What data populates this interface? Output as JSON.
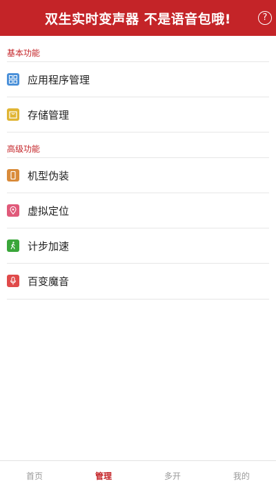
{
  "header": {
    "title": "双生实时变声器 不是语音包哦!",
    "help_glyph": "?",
    "color": "#c42428"
  },
  "sections": {
    "basic": {
      "title": "基本功能",
      "items": [
        {
          "label": "应用程序管理",
          "icon": "grid-apps-icon",
          "color": "#4a90d9"
        },
        {
          "label": "存储管理",
          "icon": "storage-bag-icon",
          "color": "#e0b534"
        }
      ]
    },
    "advanced": {
      "title": "高级功能",
      "items": [
        {
          "label": "机型伪装",
          "icon": "phone-icon",
          "color": "#d98b3a"
        },
        {
          "label": "虚拟定位",
          "icon": "location-pin-icon",
          "color": "#e05a7a"
        },
        {
          "label": "计步加速",
          "icon": "walking-icon",
          "color": "#3aa63a"
        },
        {
          "label": "百变魔音",
          "icon": "microphone-icon",
          "color": "#e04a4a"
        }
      ]
    }
  },
  "tabbar": {
    "tabs": [
      {
        "label": "首页"
      },
      {
        "label": "管理",
        "active": true
      },
      {
        "label": "多开"
      },
      {
        "label": "我的"
      }
    ]
  }
}
